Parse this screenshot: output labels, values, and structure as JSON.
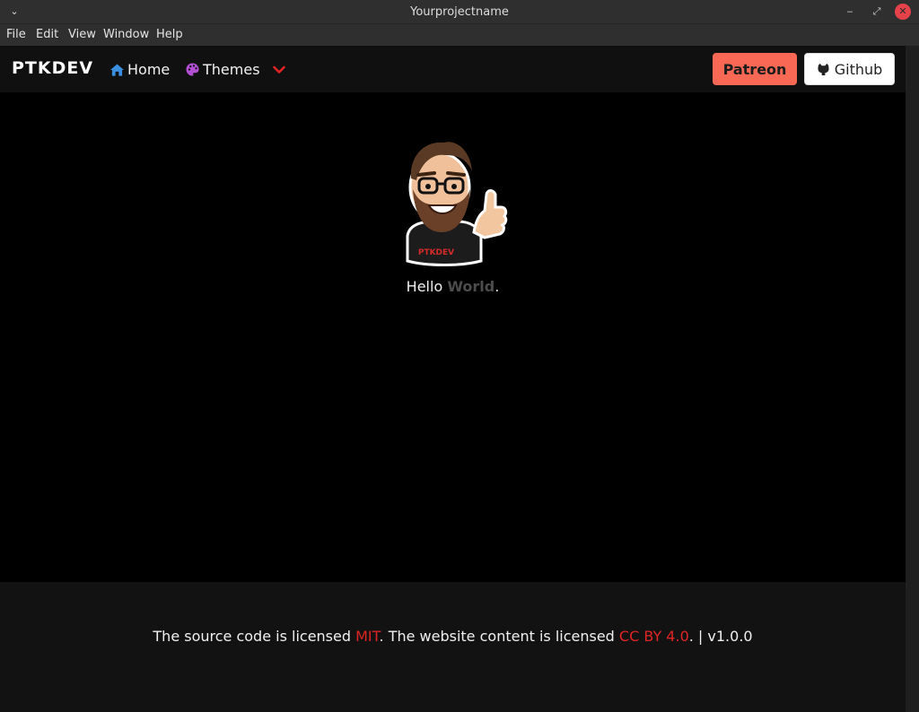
{
  "window": {
    "title": "Yourprojectname",
    "menu_glyph": "⌄",
    "min_glyph": "‒",
    "max_glyph": "⤢",
    "close_glyph": "✕"
  },
  "menubar": [
    "File",
    "Edit",
    "View",
    "Window",
    "Help"
  ],
  "nav": {
    "brand": "PTKDEV",
    "home": {
      "label": "Home",
      "icon": "home-icon"
    },
    "themes": {
      "label": "Themes",
      "icon": "palette-icon",
      "chevron": "⌄"
    }
  },
  "buttons": {
    "patreon": "Patreon",
    "github": "Github"
  },
  "hero": {
    "hello_prefix": "Hello ",
    "hello_world": "World",
    "hello_suffix": ".",
    "avatar_shirt_text": "PTKDEV"
  },
  "footer": {
    "part1": "The source code is licensed ",
    "mit": "MIT",
    "part2": ". The website content is licensed ",
    "cc": "CC BY 4.0",
    "part3": ". | v1.0.0"
  },
  "colors": {
    "accent": "#e02424",
    "patreon": "#f96854",
    "home_icon": "#3b8fe0",
    "palette_icon": "#b24fd3"
  }
}
